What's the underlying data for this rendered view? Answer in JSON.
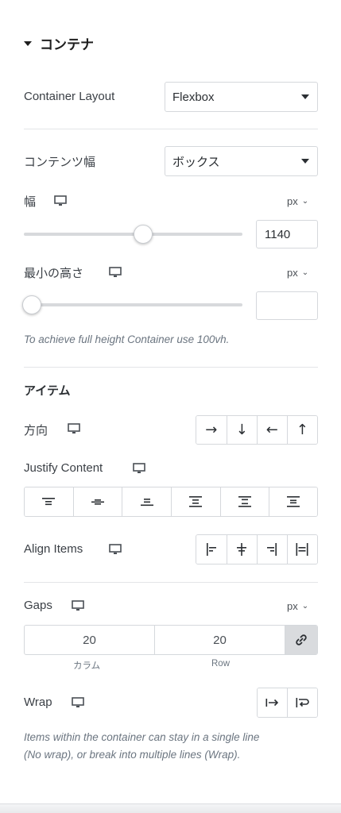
{
  "section": {
    "title": "コンテナ"
  },
  "container_layout": {
    "label": "Container Layout",
    "value": "Flexbox"
  },
  "content_width": {
    "label": "コンテンツ幅",
    "value": "ボックス"
  },
  "width": {
    "label": "幅",
    "unit": "px",
    "value": "1140",
    "slider_fraction": 0.545
  },
  "min_height": {
    "label": "最小の高さ",
    "unit": "px",
    "value": "",
    "slider_fraction": 0.0,
    "hint": "To achieve full height Container use 100vh."
  },
  "items": {
    "title": "アイテム"
  },
  "direction": {
    "label": "方向",
    "buttons": [
      "→",
      "↓",
      "←",
      "↑"
    ]
  },
  "justify": {
    "label": "Justify Content",
    "icons": [
      "justify-start-icon",
      "justify-center-icon",
      "justify-end-icon",
      "justify-space-between-icon",
      "justify-space-around-icon",
      "justify-space-evenly-icon"
    ]
  },
  "align": {
    "label": "Align Items",
    "icons": [
      "align-start-icon",
      "align-center-icon",
      "align-end-icon",
      "align-stretch-icon"
    ]
  },
  "gaps": {
    "label": "Gaps",
    "unit": "px",
    "column_value": "20",
    "row_value": "20",
    "column_label": "カラム",
    "row_label": "Row"
  },
  "wrap": {
    "label": "Wrap",
    "hint_line1": "Items within the container can stay in a single line",
    "hint_line2": "(No wrap), or break into multiple lines (Wrap)."
  },
  "colors": {
    "border": "#d5d8dc",
    "text": "#3a3f45",
    "link_bg": "#d9dbde"
  }
}
